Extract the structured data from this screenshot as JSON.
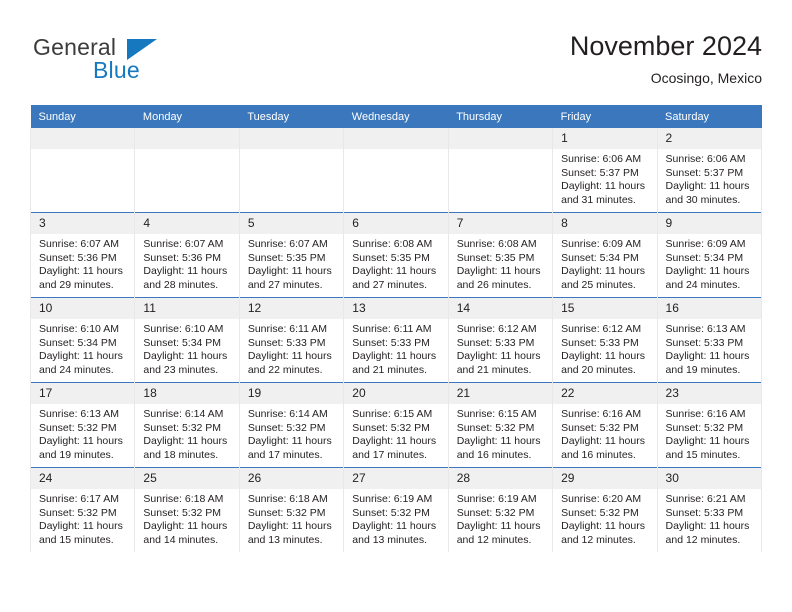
{
  "branding": {
    "name_part1": "General",
    "name_part2": "Blue",
    "triangle_icon": "triangle-logo-icon",
    "accent_color": "#1679c0"
  },
  "header": {
    "title": "November 2024",
    "location": "Ocosingo, Mexico"
  },
  "calendar": {
    "header_bg_color": "#3b77bc",
    "daynum_bg_color": "#f0f0f0",
    "weekday_labels": [
      "Sunday",
      "Monday",
      "Tuesday",
      "Wednesday",
      "Thursday",
      "Friday",
      "Saturday"
    ],
    "labels": {
      "sunrise_prefix": "Sunrise:",
      "sunset_prefix": "Sunset:",
      "daylight_prefix": "Daylight:"
    },
    "weeks": [
      [
        {
          "day": "",
          "empty": true
        },
        {
          "day": "",
          "empty": true
        },
        {
          "day": "",
          "empty": true
        },
        {
          "day": "",
          "empty": true
        },
        {
          "day": "",
          "empty": true
        },
        {
          "day": "1",
          "sunrise": "Sunrise: 6:06 AM",
          "sunset": "Sunset: 5:37 PM",
          "daylight": "Daylight: 11 hours and 31 minutes."
        },
        {
          "day": "2",
          "sunrise": "Sunrise: 6:06 AM",
          "sunset": "Sunset: 5:37 PM",
          "daylight": "Daylight: 11 hours and 30 minutes."
        }
      ],
      [
        {
          "day": "3",
          "sunrise": "Sunrise: 6:07 AM",
          "sunset": "Sunset: 5:36 PM",
          "daylight": "Daylight: 11 hours and 29 minutes."
        },
        {
          "day": "4",
          "sunrise": "Sunrise: 6:07 AM",
          "sunset": "Sunset: 5:36 PM",
          "daylight": "Daylight: 11 hours and 28 minutes."
        },
        {
          "day": "5",
          "sunrise": "Sunrise: 6:07 AM",
          "sunset": "Sunset: 5:35 PM",
          "daylight": "Daylight: 11 hours and 27 minutes."
        },
        {
          "day": "6",
          "sunrise": "Sunrise: 6:08 AM",
          "sunset": "Sunset: 5:35 PM",
          "daylight": "Daylight: 11 hours and 27 minutes."
        },
        {
          "day": "7",
          "sunrise": "Sunrise: 6:08 AM",
          "sunset": "Sunset: 5:35 PM",
          "daylight": "Daylight: 11 hours and 26 minutes."
        },
        {
          "day": "8",
          "sunrise": "Sunrise: 6:09 AM",
          "sunset": "Sunset: 5:34 PM",
          "daylight": "Daylight: 11 hours and 25 minutes."
        },
        {
          "day": "9",
          "sunrise": "Sunrise: 6:09 AM",
          "sunset": "Sunset: 5:34 PM",
          "daylight": "Daylight: 11 hours and 24 minutes."
        }
      ],
      [
        {
          "day": "10",
          "sunrise": "Sunrise: 6:10 AM",
          "sunset": "Sunset: 5:34 PM",
          "daylight": "Daylight: 11 hours and 24 minutes."
        },
        {
          "day": "11",
          "sunrise": "Sunrise: 6:10 AM",
          "sunset": "Sunset: 5:34 PM",
          "daylight": "Daylight: 11 hours and 23 minutes."
        },
        {
          "day": "12",
          "sunrise": "Sunrise: 6:11 AM",
          "sunset": "Sunset: 5:33 PM",
          "daylight": "Daylight: 11 hours and 22 minutes."
        },
        {
          "day": "13",
          "sunrise": "Sunrise: 6:11 AM",
          "sunset": "Sunset: 5:33 PM",
          "daylight": "Daylight: 11 hours and 21 minutes."
        },
        {
          "day": "14",
          "sunrise": "Sunrise: 6:12 AM",
          "sunset": "Sunset: 5:33 PM",
          "daylight": "Daylight: 11 hours and 21 minutes."
        },
        {
          "day": "15",
          "sunrise": "Sunrise: 6:12 AM",
          "sunset": "Sunset: 5:33 PM",
          "daylight": "Daylight: 11 hours and 20 minutes."
        },
        {
          "day": "16",
          "sunrise": "Sunrise: 6:13 AM",
          "sunset": "Sunset: 5:33 PM",
          "daylight": "Daylight: 11 hours and 19 minutes."
        }
      ],
      [
        {
          "day": "17",
          "sunrise": "Sunrise: 6:13 AM",
          "sunset": "Sunset: 5:32 PM",
          "daylight": "Daylight: 11 hours and 19 minutes."
        },
        {
          "day": "18",
          "sunrise": "Sunrise: 6:14 AM",
          "sunset": "Sunset: 5:32 PM",
          "daylight": "Daylight: 11 hours and 18 minutes."
        },
        {
          "day": "19",
          "sunrise": "Sunrise: 6:14 AM",
          "sunset": "Sunset: 5:32 PM",
          "daylight": "Daylight: 11 hours and 17 minutes."
        },
        {
          "day": "20",
          "sunrise": "Sunrise: 6:15 AM",
          "sunset": "Sunset: 5:32 PM",
          "daylight": "Daylight: 11 hours and 17 minutes."
        },
        {
          "day": "21",
          "sunrise": "Sunrise: 6:15 AM",
          "sunset": "Sunset: 5:32 PM",
          "daylight": "Daylight: 11 hours and 16 minutes."
        },
        {
          "day": "22",
          "sunrise": "Sunrise: 6:16 AM",
          "sunset": "Sunset: 5:32 PM",
          "daylight": "Daylight: 11 hours and 16 minutes."
        },
        {
          "day": "23",
          "sunrise": "Sunrise: 6:16 AM",
          "sunset": "Sunset: 5:32 PM",
          "daylight": "Daylight: 11 hours and 15 minutes."
        }
      ],
      [
        {
          "day": "24",
          "sunrise": "Sunrise: 6:17 AM",
          "sunset": "Sunset: 5:32 PM",
          "daylight": "Daylight: 11 hours and 15 minutes."
        },
        {
          "day": "25",
          "sunrise": "Sunrise: 6:18 AM",
          "sunset": "Sunset: 5:32 PM",
          "daylight": "Daylight: 11 hours and 14 minutes."
        },
        {
          "day": "26",
          "sunrise": "Sunrise: 6:18 AM",
          "sunset": "Sunset: 5:32 PM",
          "daylight": "Daylight: 11 hours and 13 minutes."
        },
        {
          "day": "27",
          "sunrise": "Sunrise: 6:19 AM",
          "sunset": "Sunset: 5:32 PM",
          "daylight": "Daylight: 11 hours and 13 minutes."
        },
        {
          "day": "28",
          "sunrise": "Sunrise: 6:19 AM",
          "sunset": "Sunset: 5:32 PM",
          "daylight": "Daylight: 11 hours and 12 minutes."
        },
        {
          "day": "29",
          "sunrise": "Sunrise: 6:20 AM",
          "sunset": "Sunset: 5:32 PM",
          "daylight": "Daylight: 11 hours and 12 minutes."
        },
        {
          "day": "30",
          "sunrise": "Sunrise: 6:21 AM",
          "sunset": "Sunset: 5:33 PM",
          "daylight": "Daylight: 11 hours and 12 minutes."
        }
      ]
    ]
  }
}
